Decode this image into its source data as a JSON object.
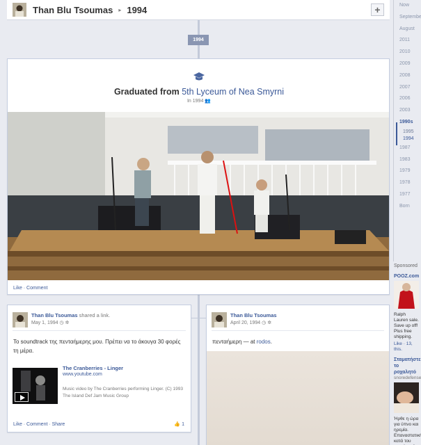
{
  "header": {
    "name": "Than Blu Tsoumas",
    "separator": "▸",
    "year": "1994",
    "plus": "+"
  },
  "scrubber": {
    "items": [
      {
        "label": "Now"
      },
      {
        "label": "September"
      },
      {
        "label": "August"
      },
      {
        "label": "2011"
      },
      {
        "label": "2010"
      },
      {
        "label": "2009"
      },
      {
        "label": "2008"
      },
      {
        "label": "2007"
      },
      {
        "label": "2006"
      },
      {
        "label": "2003"
      },
      {
        "label": "1990s"
      },
      {
        "label": "1995"
      },
      {
        "label": "1994"
      },
      {
        "label": "1987"
      },
      {
        "label": "1983"
      },
      {
        "label": "1979"
      },
      {
        "label": "1978"
      },
      {
        "label": "1977"
      },
      {
        "label": "Born"
      }
    ]
  },
  "timeline": {
    "year_marker": "1994"
  },
  "grad": {
    "prefix": "Graduated from ",
    "school": "5th Lyceum of Nea Smyrni",
    "when": "In 1994",
    "footer": "Like · Comment"
  },
  "post_left": {
    "name": "Than Blu Tsoumas",
    "shared": " shared a link.",
    "date": "May 1, 1994",
    "message": "Το soundtrack της πενταήμερης μου. Πρέπει να το άκουγα 30 φορές τη μέρα.",
    "link_title": "The Cranberries - Linger",
    "link_url": "www.youtube.com",
    "link_desc": "Music video by The Cranberries performing Linger. (C) 1993 The Island Def Jam Music Group",
    "footer": "Like · Comment · Share",
    "like_count": "1"
  },
  "post_right": {
    "name": "Than Blu Tsoumas",
    "date": "April 20, 1994",
    "message_prefix": "πενταήμερη — at ",
    "place": "rodos",
    "message_suffix": "."
  },
  "sponsored": {
    "heading": "Sponsored",
    "ad1_title": "POOZ.com",
    "ad1_text": "Ralph Lauren sale. Save up off! Plus free shipping.",
    "ad1_like": "Like · 13, this.",
    "ad2_title": "Σταματήστε το ροχαλητό",
    "ad2_domain": "snoredefense",
    "ad2_text": "Ήρθε η ώρα για ύπνο και ηρεμία. Επαναστατική κατά του ροχαλητού. Μάθετε περισσότερα"
  },
  "colors": {
    "link": "#3b5998",
    "spine": "#c3cad9",
    "background": "#e9ebf1"
  }
}
